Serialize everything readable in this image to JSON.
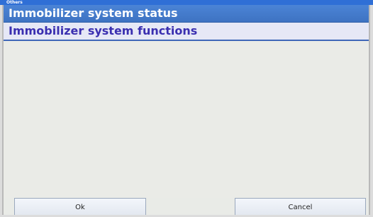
{
  "window": {
    "title": "Others"
  },
  "header": {
    "title": "Immobilizer system status"
  },
  "subheader": {
    "title": "Immobilizer system functions"
  },
  "buttons": {
    "ok_label": "Ok",
    "cancel_label": "Cancel"
  },
  "colors": {
    "titlebar": "#2f6fd6",
    "header_bg": "#4b84d6",
    "subheader_text": "#3a2fb0",
    "panel_bg": "#e9ebe7"
  }
}
